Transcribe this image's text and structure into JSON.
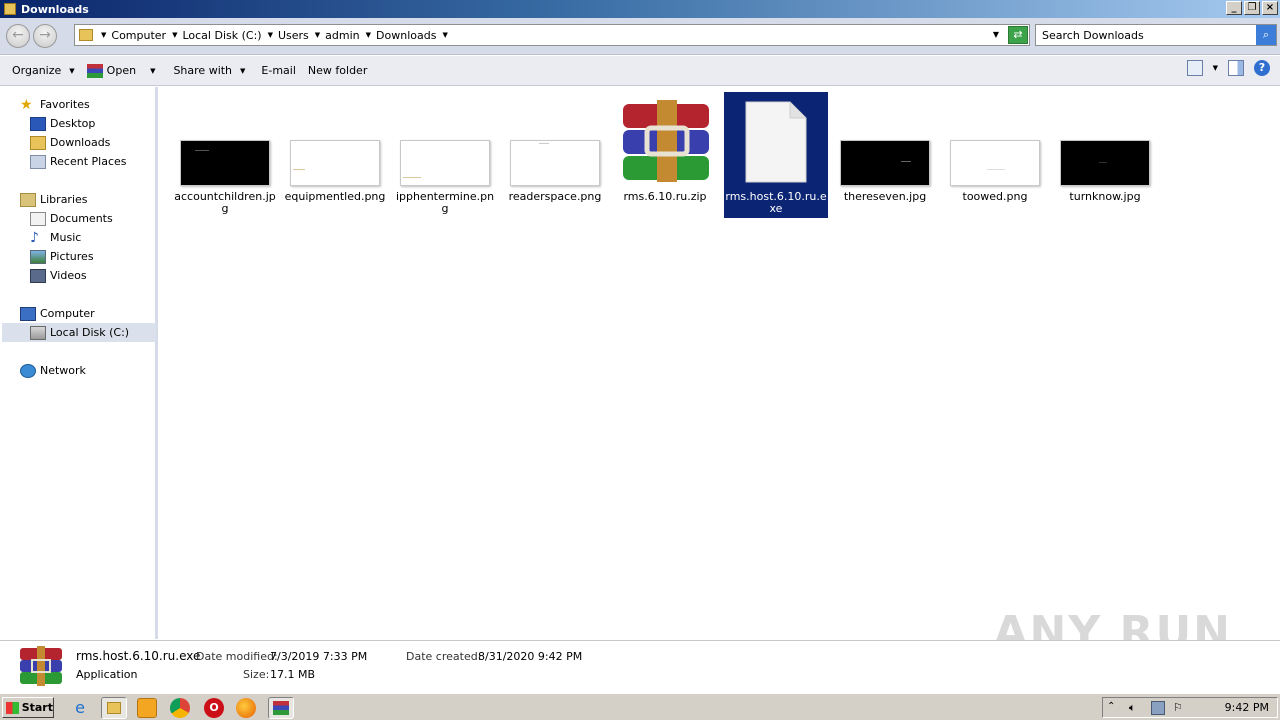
{
  "window": {
    "title": "Downloads"
  },
  "address": {
    "crumbs": [
      "Computer",
      "Local Disk (C:)",
      "Users",
      "admin",
      "Downloads"
    ],
    "search_placeholder": "Search Downloads"
  },
  "toolbar": {
    "organize": "Organize",
    "open": "Open",
    "share_with": "Share with",
    "email": "E-mail",
    "new_folder": "New folder"
  },
  "nav": {
    "favorites": "Favorites",
    "desktop": "Desktop",
    "downloads": "Downloads",
    "recent_places": "Recent Places",
    "libraries": "Libraries",
    "documents": "Documents",
    "music": "Music",
    "pictures": "Pictures",
    "videos": "Videos",
    "computer": "Computer",
    "local_disk": "Local Disk (C:)",
    "network": "Network"
  },
  "files": [
    {
      "name": "accountchildren.jpg",
      "kind": "dark-image"
    },
    {
      "name": "equipmentled.png",
      "kind": "light-image"
    },
    {
      "name": "ipphentermine.png",
      "kind": "light-image"
    },
    {
      "name": "readerspace.png",
      "kind": "light-image"
    },
    {
      "name": "rms.6.10.ru.zip",
      "kind": "winrar-archive"
    },
    {
      "name": "rms.host.6.10.ru.exe",
      "kind": "generic-file",
      "selected": true
    },
    {
      "name": "thereseven.jpg",
      "kind": "dark-image"
    },
    {
      "name": "toowed.png",
      "kind": "light-image"
    },
    {
      "name": "turnknow.jpg",
      "kind": "dark-image"
    }
  ],
  "details": {
    "name": "rms.host.6.10.ru.exe",
    "type": "Application",
    "date_modified_label": "Date modified:",
    "date_modified": "7/3/2019 7:33 PM",
    "size_label": "Size:",
    "size": "17.1 MB",
    "date_created_label": "Date created:",
    "date_created": "8/31/2020 9:42 PM"
  },
  "watermark": "ANY RUN",
  "taskbar": {
    "start": "Start",
    "clock": "9:42 PM"
  }
}
